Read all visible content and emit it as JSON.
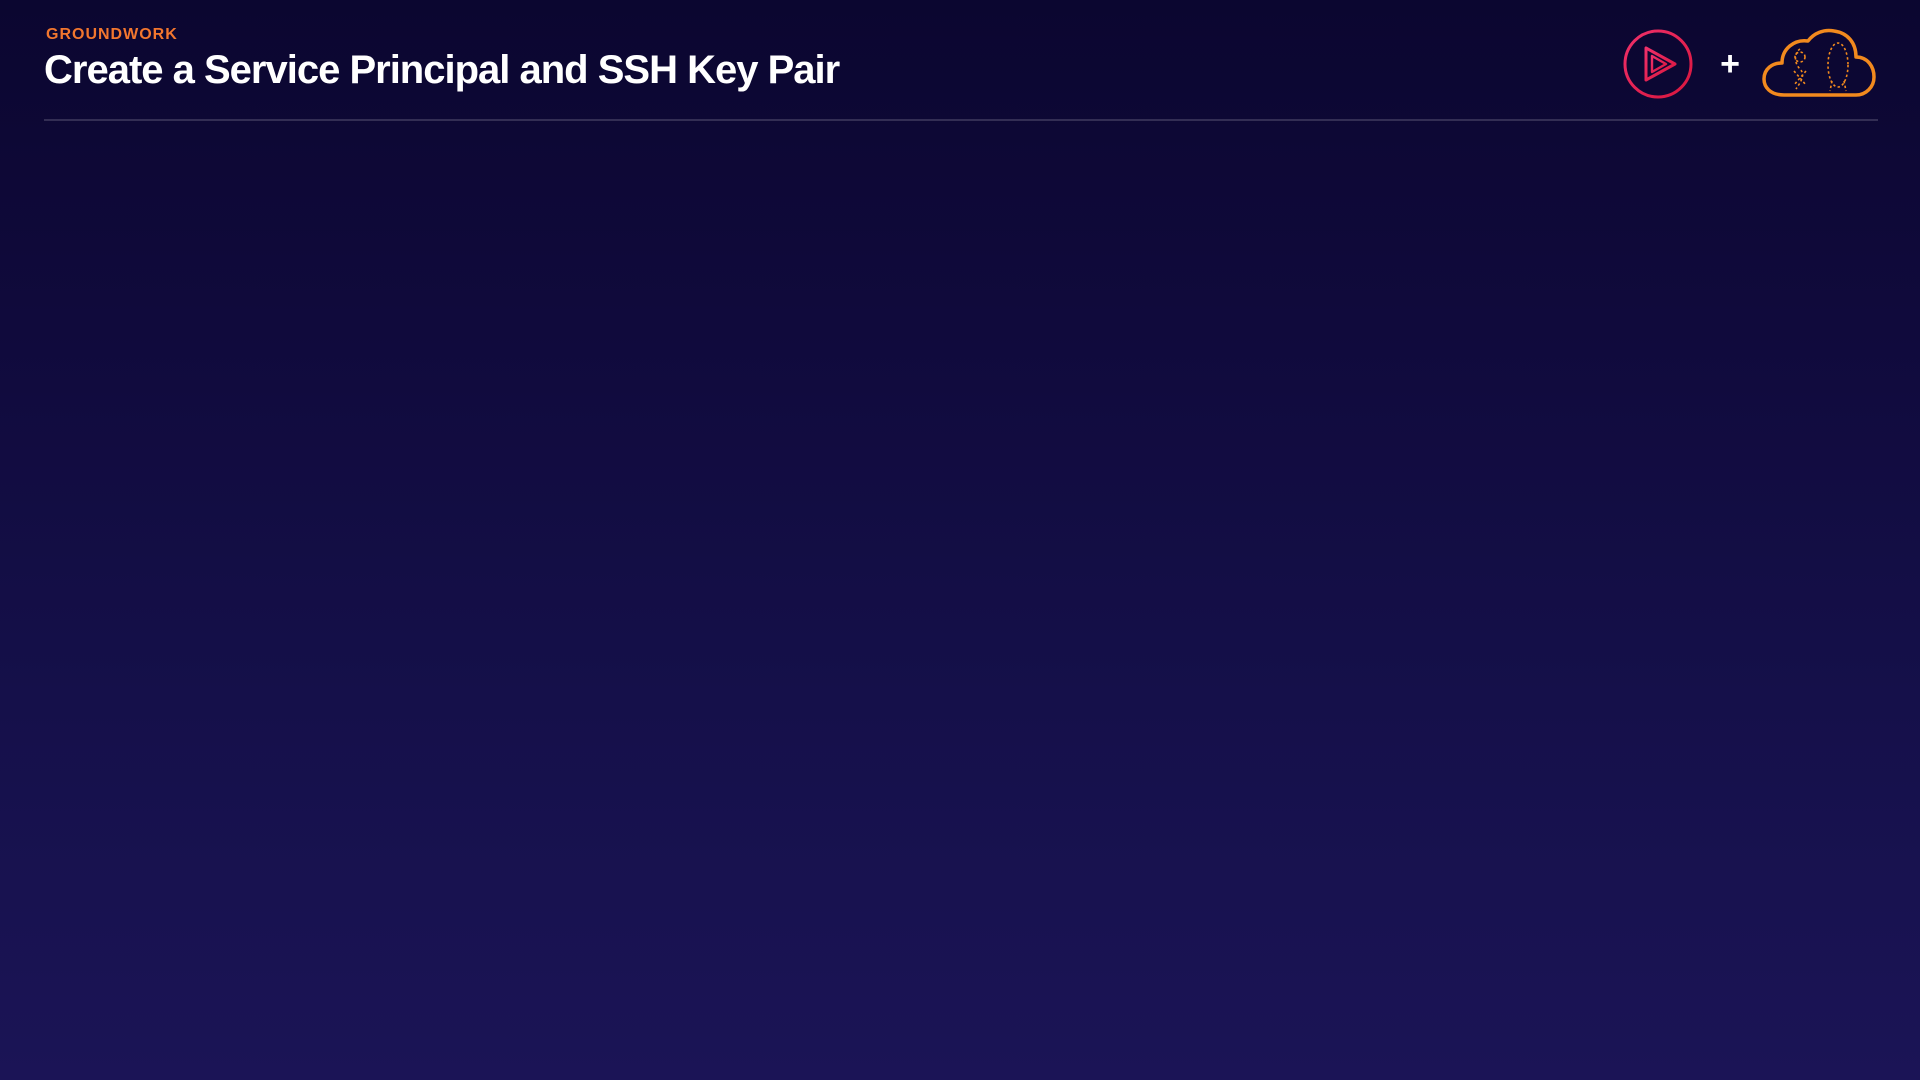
{
  "slide": {
    "eyebrow": "GROUNDWORK",
    "title": "Create a Service Principal and SSH Key Pair",
    "plus_symbol": "+"
  },
  "logos": {
    "left_icon": "play-circle-logo-icon",
    "right_icon": "cloud-logo-icon"
  },
  "colors": {
    "background_top": "#0b0630",
    "background_bottom": "#1b1456",
    "eyebrow": "#f2762e",
    "title": "#ffffff",
    "play_logo_start": "#f01e5a",
    "play_logo_end": "#e4184a",
    "cloud_logo": "#f28a1e"
  }
}
